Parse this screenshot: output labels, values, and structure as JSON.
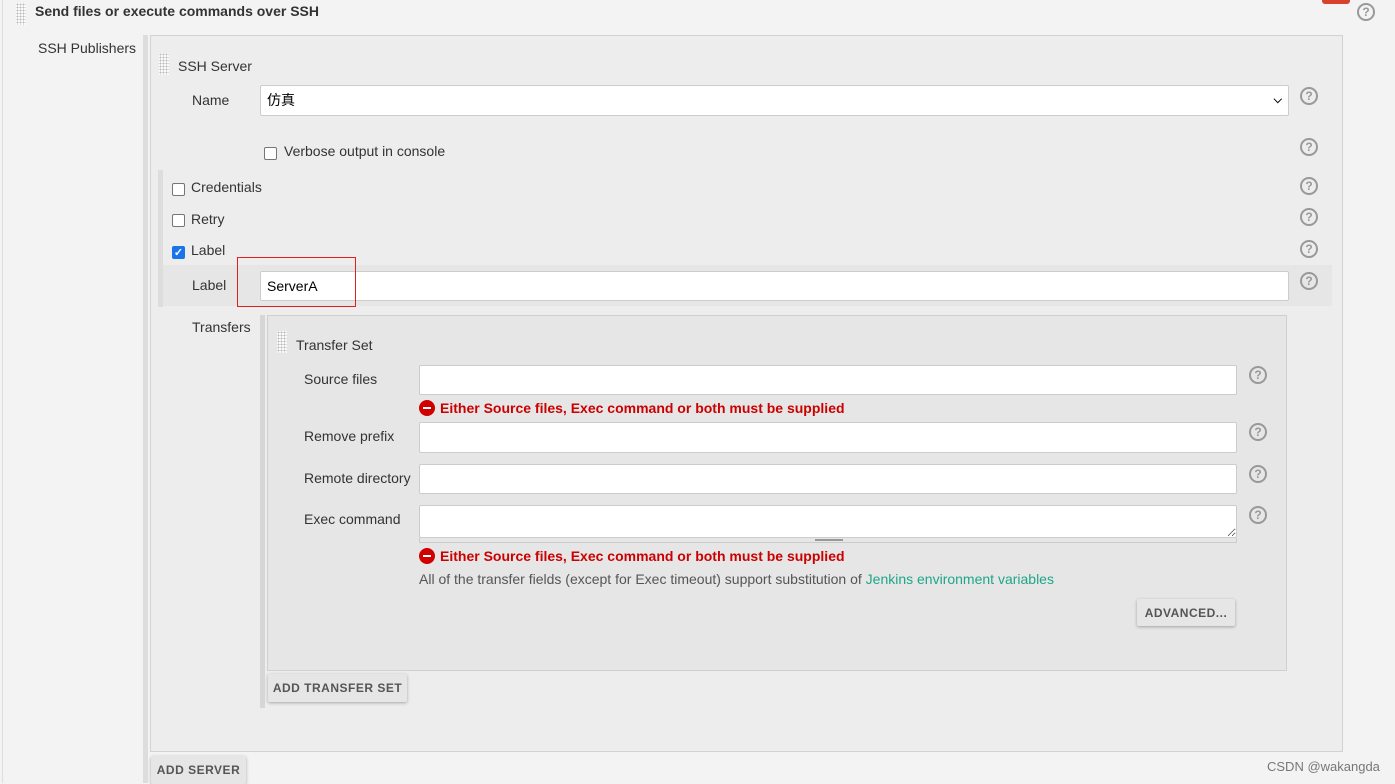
{
  "section": {
    "title": "Send files or execute commands over SSH"
  },
  "publishers": {
    "label": "SSH Publishers"
  },
  "server": {
    "title": "SSH Server",
    "name_label": "Name",
    "name_value": "仿真",
    "verbose_label": "Verbose output in console",
    "verbose_checked": false,
    "credentials_label": "Credentials",
    "credentials_checked": false,
    "retry_label": "Retry",
    "retry_checked": false,
    "label_toggle": "Label",
    "label_checked": true,
    "label_field_label": "Label",
    "label_value": "ServerA",
    "transfers_label": "Transfers"
  },
  "transfer": {
    "title": "Transfer Set",
    "source_label": "Source files",
    "source_value": "",
    "error": "Either Source files, Exec command or both must be supplied",
    "prefix_label": "Remove prefix",
    "prefix_value": "",
    "remote_label": "Remote directory",
    "remote_value": "",
    "exec_label": "Exec command",
    "exec_value": "",
    "note": "All of the transfer fields (except for Exec timeout) support substitution of ",
    "note_link": "Jenkins environment variables",
    "advanced": "ADVANCED...",
    "add_transfer": "ADD TRANSFER SET"
  },
  "add_server": "ADD SERVER",
  "help_symbol": "?",
  "watermark": "CSDN @wakangda",
  "colors": {
    "error": "#cc0000",
    "link": "#1ea68a",
    "highlight_box": "#e02020"
  }
}
